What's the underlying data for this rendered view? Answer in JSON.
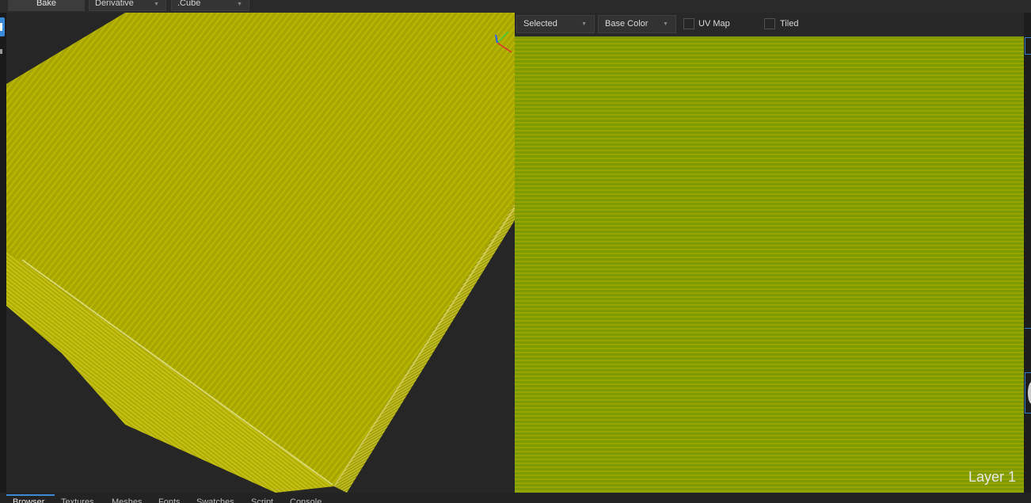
{
  "toolbar": {
    "bake_label": "Bake",
    "bake_type": "Derivative",
    "mesh_target": ".Cube"
  },
  "uv_toolbar": {
    "object_filter": "Selected",
    "channel": "Base Color",
    "uv_map_label": "UV Map",
    "uv_map_checked": false,
    "tiled_label": "Tiled",
    "tiled_checked": false
  },
  "uv_view": {
    "layer_label": "Layer 1"
  },
  "bottom_tabs": {
    "browser": "Browser",
    "textures": "Textures",
    "meshes": "Meshes",
    "fonts": "Fonts",
    "swatches": "Swatches",
    "script": "Script",
    "console": "Console",
    "active": "Browser"
  },
  "colors": {
    "accent": "#3b8ad8",
    "mesh_yellow": "#b8b400",
    "texture_green": "#7d9a00"
  },
  "icons": {
    "axis_gizmo": "axis-gizmo-icon",
    "dropdown_arrow": "chevron-down-icon"
  }
}
